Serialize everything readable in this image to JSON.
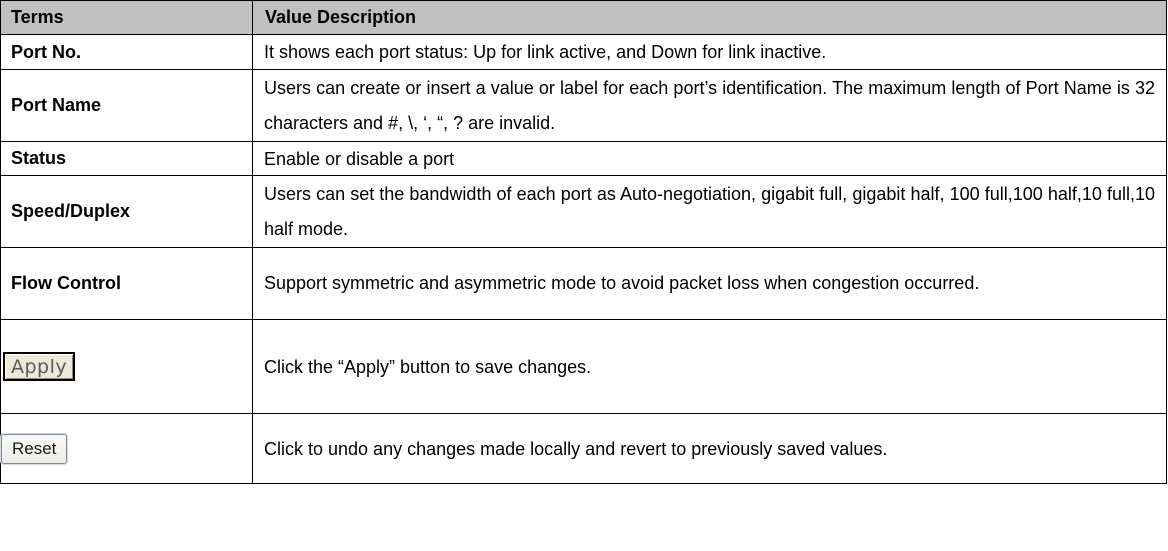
{
  "header": {
    "terms": "Terms",
    "value_description": "Value Description"
  },
  "rows": [
    {
      "term": "Port No.",
      "desc": "It shows each port status: Up for link active, and Down for link inactive."
    },
    {
      "term": "Port Name",
      "desc": "Users can create or insert a value or label for each port’s identification. The maximum length of Port Name is 32 characters and #, \\, ‘, “, ? are invalid."
    },
    {
      "term": "Status",
      "desc": "Enable or disable a port"
    },
    {
      "term": "Speed/Duplex",
      "desc": "Users can set the bandwidth of each port as Auto-negotiation, gigabit full, gigabit half, 100 full,100 half,10 full,10 half mode."
    },
    {
      "term": "Flow Control",
      "desc": "Support symmetric and asymmetric mode to avoid packet loss when congestion occurred."
    }
  ],
  "apply": {
    "button_label": "Apply",
    "desc": "Click the “Apply” button to save changes."
  },
  "reset": {
    "button_label": "Reset",
    "desc": "Click to undo any changes made locally and revert to previously saved values."
  }
}
